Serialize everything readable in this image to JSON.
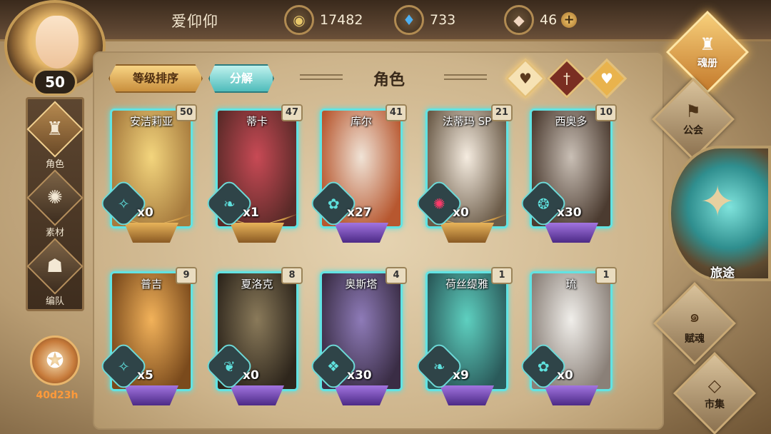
{
  "player": {
    "name": "爱仰仰",
    "level": "50"
  },
  "currencies": [
    {
      "icon": "gold-coin-icon",
      "value": "17482"
    },
    {
      "icon": "blue-crystal-icon",
      "value": "733"
    },
    {
      "icon": "gem-stone-icon",
      "value": "46"
    }
  ],
  "left_menu": [
    {
      "label": "角色",
      "icon": "helmet-icon",
      "active": true
    },
    {
      "label": "素材",
      "icon": "beast-icon",
      "active": false
    },
    {
      "label": "编队",
      "icon": "team-icon",
      "active": false
    }
  ],
  "event_timer": "40d23h",
  "panel": {
    "sort_button": "等级排序",
    "decompose_button": "分解",
    "title": "角色",
    "filters": [
      "heart-filter-icon",
      "sword-filter-icon",
      "shield-filter-icon"
    ]
  },
  "cards": [
    {
      "name": "安洁莉亚",
      "level": "50",
      "count": "x0",
      "rarity": "gold",
      "palette": [
        "#f3d57d",
        "#a67a3d"
      ]
    },
    {
      "name": "蒂卡",
      "level": "47",
      "count": "x1",
      "rarity": "gold",
      "palette": [
        "#c84a55",
        "#5a2a28"
      ]
    },
    {
      "name": "库尔",
      "level": "41",
      "count": "x27",
      "rarity": "purple",
      "palette": [
        "#f0e3d6",
        "#b7572f"
      ]
    },
    {
      "name": "法蒂玛 SP",
      "level": "21",
      "count": "x0",
      "rarity": "gold",
      "palette": [
        "#f5ece0",
        "#6b5b48"
      ]
    },
    {
      "name": "西奥多",
      "level": "10",
      "count": "x30",
      "rarity": "purple",
      "palette": [
        "#c9bfb5",
        "#4b3b30"
      ]
    },
    {
      "name": "普吉",
      "level": "9",
      "count": "x5",
      "rarity": "purple",
      "palette": [
        "#f2b25a",
        "#7a4a1c"
      ]
    },
    {
      "name": "夏洛克",
      "level": "8",
      "count": "x0",
      "rarity": "purple",
      "palette": [
        "#8a7a5a",
        "#2e261c"
      ]
    },
    {
      "name": "奥斯塔",
      "level": "4",
      "count": "x30",
      "rarity": "purple",
      "palette": [
        "#8e7bb8",
        "#3a2d45"
      ]
    },
    {
      "name": "荷丝缇雅",
      "level": "1",
      "count": "x9",
      "rarity": "purple",
      "palette": [
        "#5ed0c0",
        "#2a5a5a"
      ]
    },
    {
      "name": "琉",
      "level": "1",
      "count": "x0",
      "rarity": "purple",
      "palette": [
        "#f0eeea",
        "#8a8078"
      ]
    }
  ],
  "right_nav": [
    {
      "label": "魂册",
      "icon": "helmet-icon",
      "active": true
    },
    {
      "label": "公会",
      "icon": "banner-icon",
      "active": false
    },
    {
      "label": "旅途",
      "icon": "compass-icon",
      "active": false
    },
    {
      "label": "赋魂",
      "icon": "spiral-icon",
      "active": false
    },
    {
      "label": "市集",
      "icon": "gem-icon",
      "active": false
    }
  ],
  "colors": {
    "card_glow": "#62e3e3",
    "rarity_gold": "#e8b45a",
    "rarity_purple": "#a274e0",
    "timer": "#ff9a3a"
  }
}
